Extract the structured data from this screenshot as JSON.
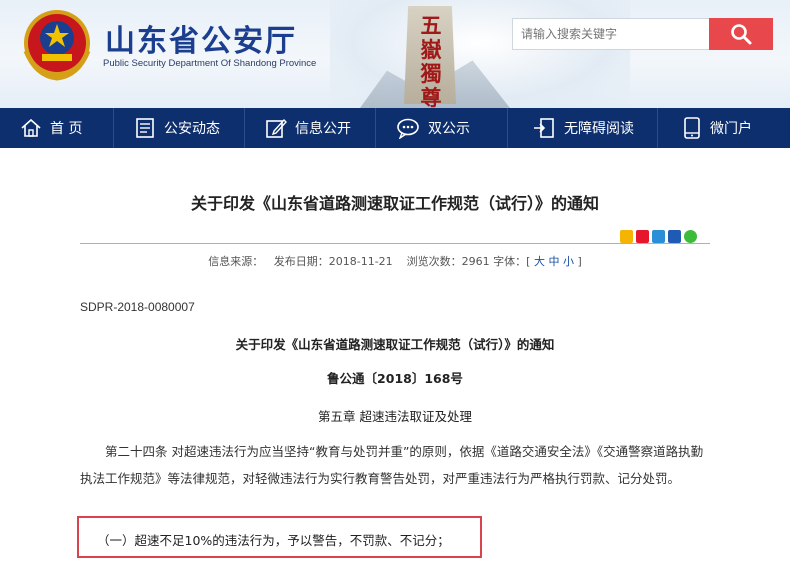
{
  "header": {
    "site_title": "山东省公安厅",
    "site_subtitle": "Public Security Department Of Shandong Province",
    "stele_text": "五嶽獨尊",
    "search_placeholder": "请输入搜索关键字"
  },
  "nav": {
    "items": [
      {
        "label": "首 页",
        "icon": "home-icon"
      },
      {
        "label": "公安动态",
        "icon": "news-icon"
      },
      {
        "label": "信息公开",
        "icon": "edit-icon"
      },
      {
        "label": "双公示",
        "icon": "chat-icon"
      },
      {
        "label": "无障碍阅读",
        "icon": "accessibility-icon"
      },
      {
        "label": "微门户",
        "icon": "mobile-icon"
      }
    ]
  },
  "article": {
    "title": "关于印发《山东省道路测速取证工作规范（试行）》的通知",
    "meta_source": "信息来源：",
    "meta_date": "发布日期：2018-11-21",
    "meta_views": "浏览次数：2961",
    "meta_font_label": "字体：[",
    "font_large": "大",
    "font_medium": "中",
    "font_small": "小",
    "meta_font_end": "]",
    "doc_number": "SDPR-2018-0080007",
    "inner_title": "关于印发《山东省道路测速取证工作规范（试行）》的通知",
    "issue_number": "鲁公通〔2018〕168号",
    "chapter": "第五章 超速违法取证及处理",
    "paragraph": "第二十四条 对超速违法行为应当坚持“教育与处罚并重”的原则，依据《道路交通安全法》《交通警察道路执勤执法工作规范》等法律规范，对轻微违法行为实行教育警告处罚，对严重违法行为严格执行罚款、记分处罚。",
    "highlight": "（一）超速不足10%的违法行为，予以警告，不罚款、不记分；"
  },
  "colors": {
    "nav_bg": "#0e2f6e",
    "title_blue": "#1b3f8e",
    "search_red": "#e8474c",
    "highlight_border": "#d9434b"
  }
}
